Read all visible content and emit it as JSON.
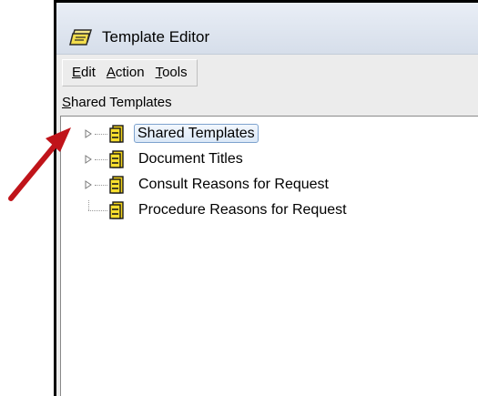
{
  "window": {
    "title": "Template Editor",
    "title_icon": "template-editor-icon"
  },
  "menu": {
    "items": [
      {
        "mnemonic": "E",
        "rest": "dit"
      },
      {
        "mnemonic": "A",
        "rest": "ction"
      },
      {
        "mnemonic": "T",
        "rest": "ools"
      }
    ]
  },
  "section": {
    "mnemonic": "S",
    "rest": "hared Templates"
  },
  "tree": {
    "node_icon": "folder-cabinet-icon",
    "expander_icon": "triangle-right-icon",
    "items": [
      {
        "label": "Shared Templates",
        "selected": true,
        "expandable": true
      },
      {
        "label": "Document Titles",
        "selected": false,
        "expandable": true
      },
      {
        "label": "Consult Reasons for Request",
        "selected": false,
        "expandable": true
      },
      {
        "label": "Procedure Reasons for Request",
        "selected": false,
        "expandable": false
      }
    ]
  },
  "annotation": {
    "arrow_icon": "red-arrow-icon",
    "color": "#c0141a"
  },
  "colors": {
    "titlebar": "#dbe3ef",
    "selection_border": "#7da2ce",
    "icon_yellow": "#f2d21a"
  }
}
